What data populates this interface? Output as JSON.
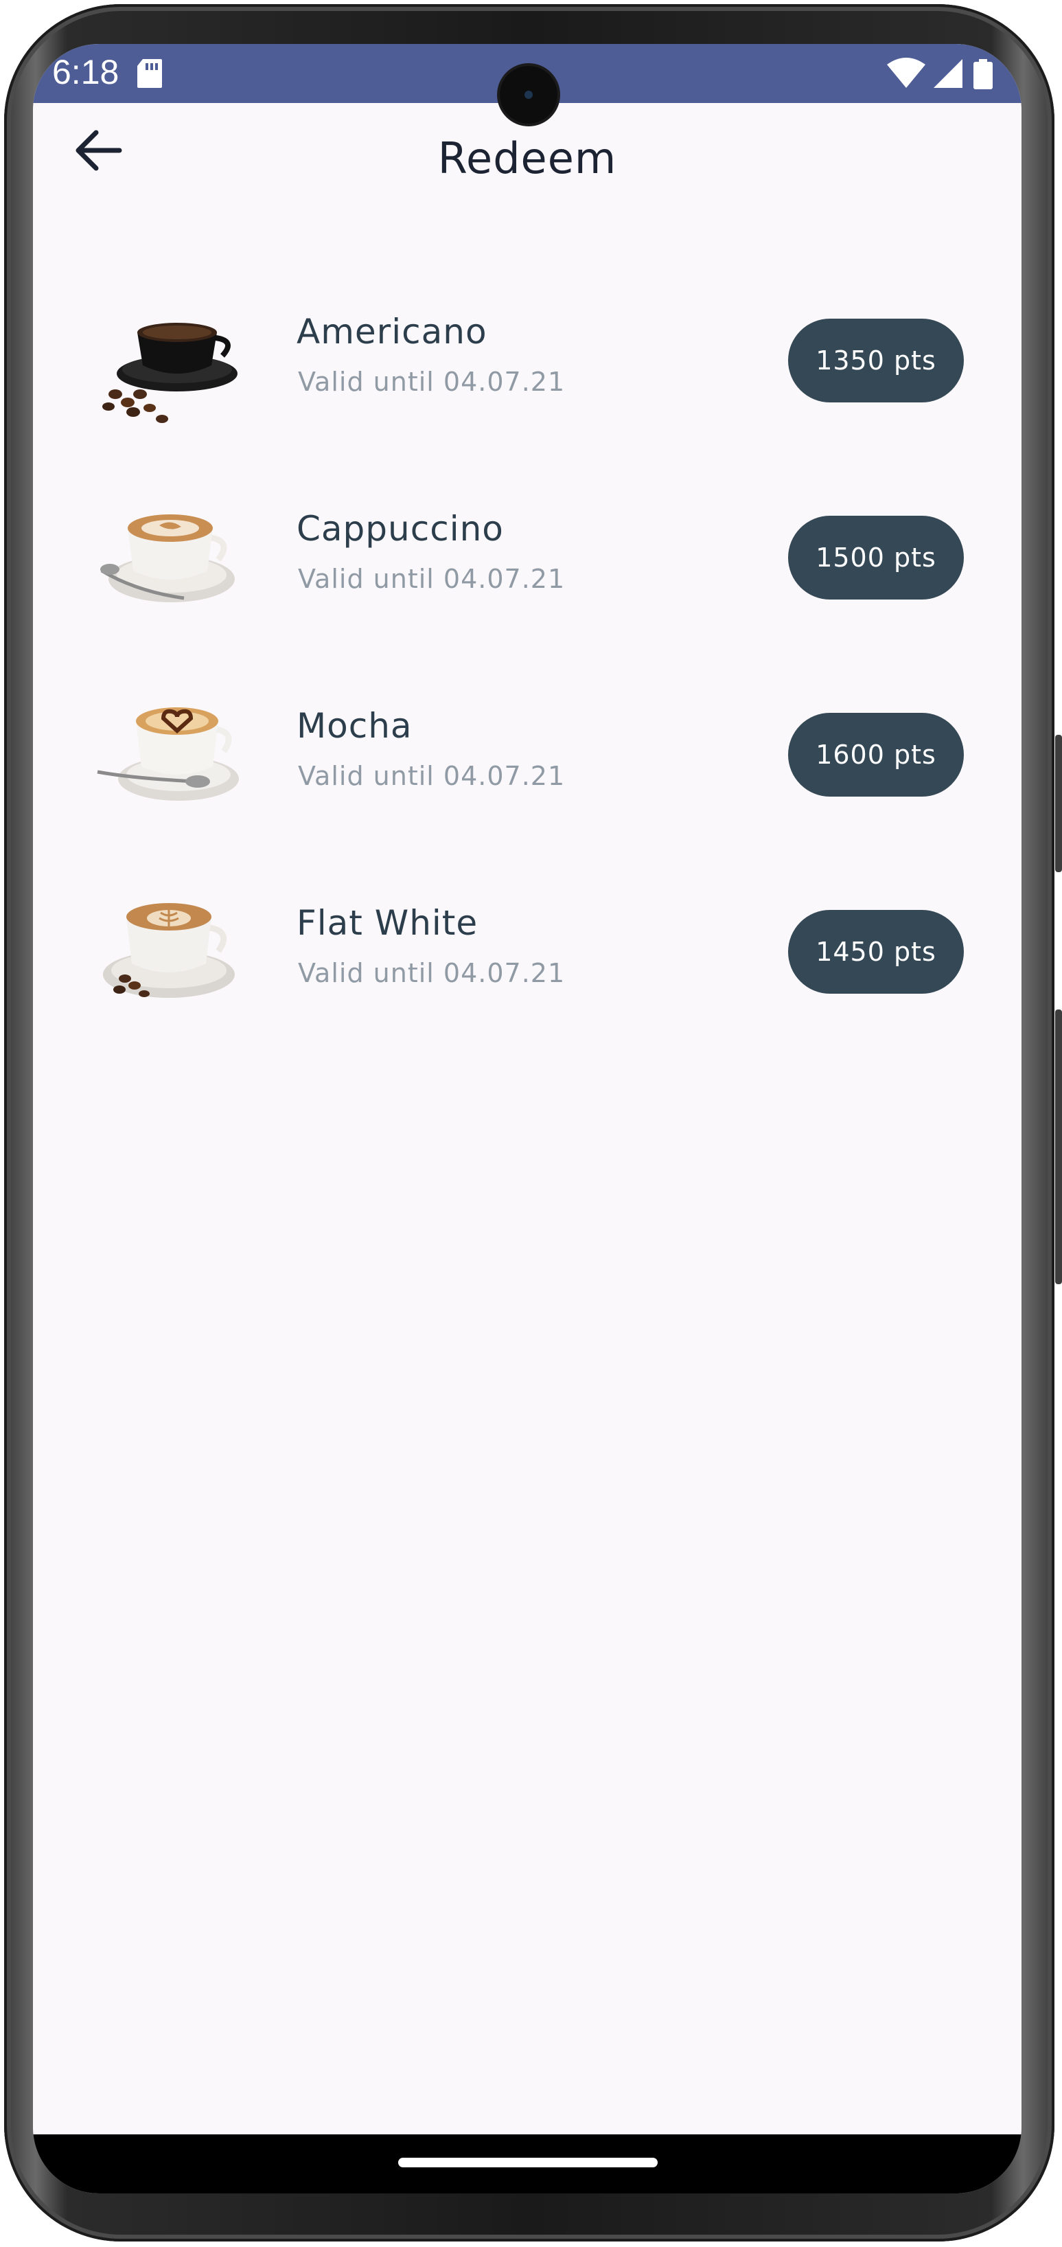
{
  "status_bar": {
    "time": "6:18",
    "icons": [
      "sd-card-icon",
      "wifi-icon",
      "signal-icon",
      "battery-icon"
    ],
    "color": "#4f5d96"
  },
  "header": {
    "title": "Redeem",
    "back_icon": "arrow-back-icon"
  },
  "items": [
    {
      "name": "Americano",
      "validity": "Valid until 04.07.21",
      "points": "1350 pts"
    },
    {
      "name": "Cappuccino",
      "validity": "Valid until 04.07.21",
      "points": "1500 pts"
    },
    {
      "name": "Mocha",
      "validity": "Valid until 04.07.21",
      "points": "1600 pts"
    },
    {
      "name": "Flat White",
      "validity": "Valid until 04.07.21",
      "points": "1450 pts"
    }
  ],
  "colors": {
    "background": "#fbf8fb",
    "button": "#354856",
    "title": "#1c2333",
    "name": "#2c3e4c",
    "validity": "#8f9aa4"
  }
}
